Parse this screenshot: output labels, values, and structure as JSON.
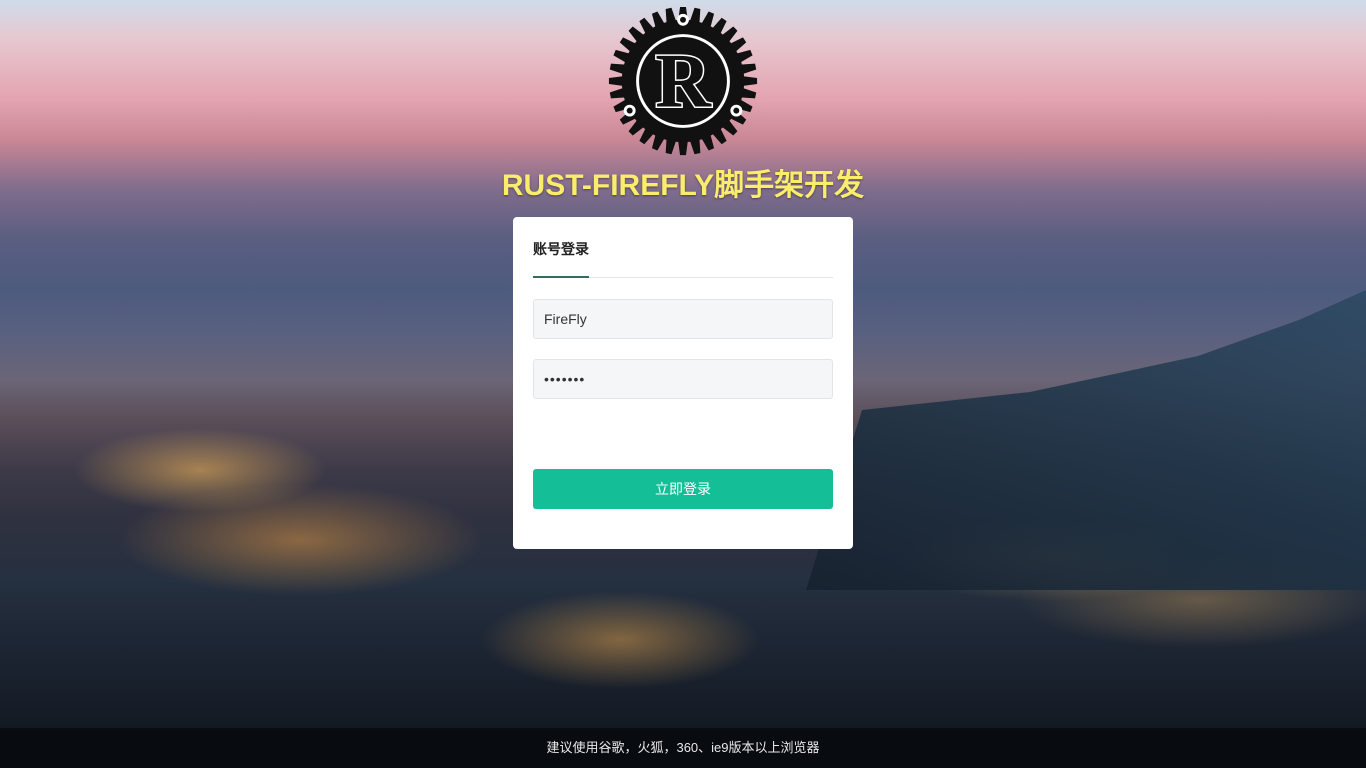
{
  "page": {
    "title": "RUST-FIREFLY脚手架开发"
  },
  "brand": {
    "logo_letter": "R",
    "title_color": "#f9ed6b"
  },
  "login": {
    "tab_label": "账号登录",
    "username_value": "FireFly",
    "password_value": "1234567",
    "submit_label": "立即登录",
    "accent_color": "#14bf98"
  },
  "footer": {
    "text": "建议使用谷歌，火狐，360、ie9版本以上浏览器"
  }
}
